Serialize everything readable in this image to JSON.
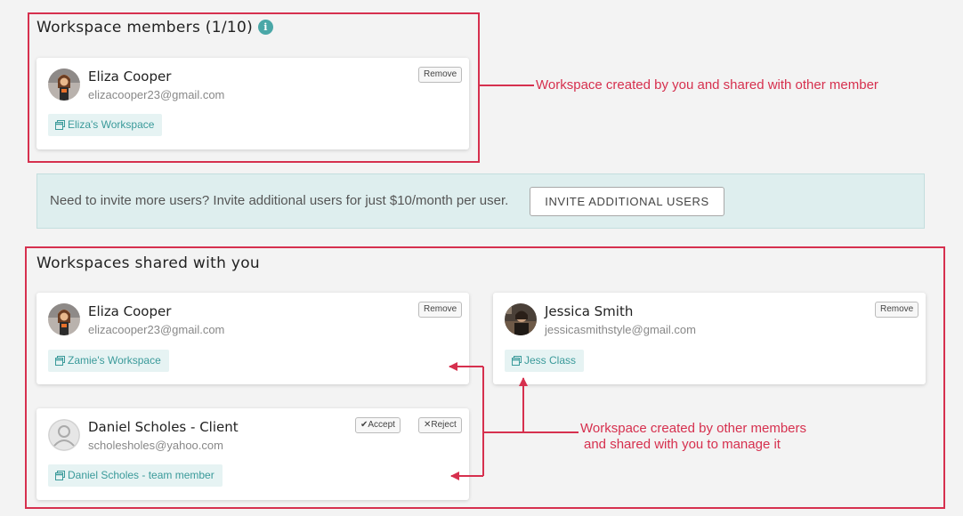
{
  "members_section": {
    "title": "Workspace members (1/10)",
    "info_icon": "info-icon",
    "members": [
      {
        "name": "Eliza Cooper",
        "email": "elizacooper23@gmail.com",
        "workspace": "Eliza's Workspace",
        "remove_label": "Remove"
      }
    ]
  },
  "banner": {
    "text": "Need to invite more users? Invite additional users for just $10/month per user.",
    "button_label": "INVITE ADDITIONAL USERS"
  },
  "shared_section": {
    "title": "Workspaces shared with you",
    "cards": [
      {
        "name": "Eliza Cooper",
        "email": "elizacooper23@gmail.com",
        "workspace": "Zamie's Workspace",
        "remove_label": "Remove"
      },
      {
        "name": "Jessica Smith",
        "email": "jessicasmithstyle@gmail.com",
        "workspace": "Jess Class",
        "remove_label": "Remove"
      },
      {
        "name": "Daniel Scholes - Client",
        "email": "scholesholes@yahoo.com",
        "workspace": "Daniel Scholes - team member",
        "accept_label": "Accept",
        "reject_label": "Reject"
      }
    ]
  },
  "annotations": {
    "top": "Workspace created by you and shared with other member",
    "bottom_line1": "Workspace created by other members",
    "bottom_line2": "and shared with you to manage it"
  },
  "colors": {
    "accent": "#4aa7a7",
    "annotation_red": "#d6304e",
    "banner_bg": "#deeeee",
    "tag_bg": "#e6f3f3"
  }
}
